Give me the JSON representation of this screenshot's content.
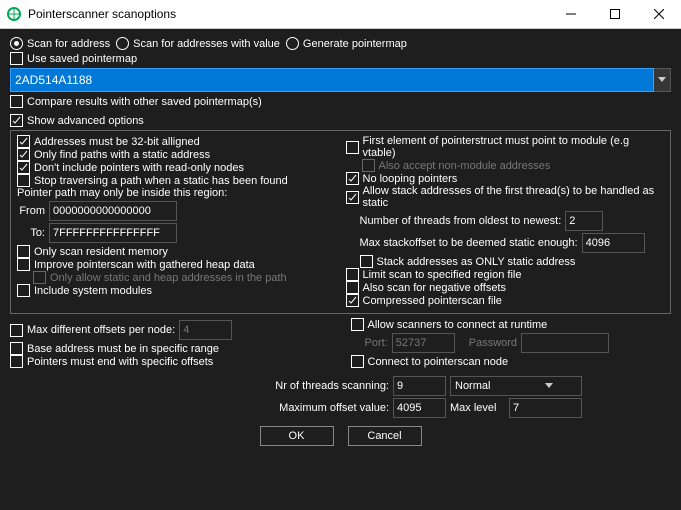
{
  "title": "Pointerscanner scanoptions",
  "radios": {
    "scan_address": "Scan for address",
    "scan_value": "Scan for addresses with value",
    "gen_map": "Generate pointermap"
  },
  "use_saved_map": "Use saved pointermap",
  "address_value": "2AD514A1188",
  "compare_results": "Compare results with other saved pointermap(s)",
  "show_advanced": "Show advanced options",
  "adv": {
    "align32": "Addresses must be 32-bit alligned",
    "static_path": "Only find paths with a static address",
    "no_readonly": "Don't include pointers with read-only nodes",
    "stop_static": "Stop traversing a path when a static has been found",
    "region_label": "Pointer path may only be inside this region:",
    "from_label": "From",
    "from_value": "0000000000000000",
    "to_label": "To:",
    "to_value": "7FFFFFFFFFFFFFFF",
    "resident": "Only scan resident memory",
    "improve_heap": "Improve pointerscan with gathered heap data",
    "only_static_heap": "Only allow static and heap addresses in the path",
    "include_sys": "Include system modules",
    "first_struct": "First element of pointerstruct must point to module (e.g vtable)",
    "accept_nonmod": "Also accept non-module addresses",
    "no_loop": "No looping pointers",
    "allow_stack": "Allow stack addresses of the first thread(s) to be handled as static",
    "threads_lbl": "Number of threads from oldest to newest:",
    "threads_val": "2",
    "stackoff_lbl": "Max stackoffset to be deemed static enough:",
    "stackoff_val": "4096",
    "stack_only": "Stack addresses as ONLY static address",
    "limit_region": "Limit scan to specified region file",
    "neg_offsets": "Also scan for negative offsets",
    "compressed": "Compressed pointerscan file"
  },
  "below": {
    "max_diff": "Max different offsets per node:",
    "max_diff_val": "4",
    "base_range": "Base address must be in specific range",
    "end_offsets": "Pointers must end with specific offsets",
    "allow_runtime": "Allow scanners to connect at runtime",
    "port_lbl": "Port:",
    "port_val": "52737",
    "pw_lbl": "Password",
    "pw_val": "",
    "connect_node": "Connect to pointerscan node"
  },
  "bottom": {
    "threads_lbl": "Nr of threads scanning:",
    "threads_val": "9",
    "priority": "Normal",
    "maxoff_lbl": "Maximum offset value:",
    "maxoff_val": "4095",
    "maxlvl_lbl": "Max level",
    "maxlvl_val": "7",
    "ok": "OK",
    "cancel": "Cancel"
  }
}
